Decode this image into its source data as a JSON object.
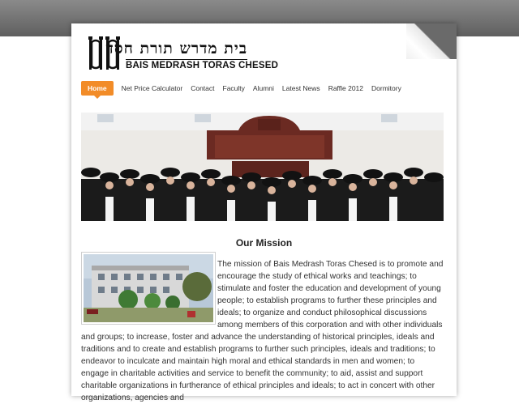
{
  "site": {
    "hebrew_name": "בית מדרש תורת חסד",
    "english_name": "BAIS MEDRASH TORAS CHESED"
  },
  "nav": {
    "items": [
      {
        "label": "Home",
        "active": true
      },
      {
        "label": "Net Price Calculator",
        "active": false
      },
      {
        "label": "Contact",
        "active": false
      },
      {
        "label": "Faculty",
        "active": false
      },
      {
        "label": "Alumni",
        "active": false
      },
      {
        "label": "Latest News",
        "active": false
      },
      {
        "label": "Raffle 2012",
        "active": false
      },
      {
        "label": "Dormitory",
        "active": false
      }
    ]
  },
  "main": {
    "title": "Our Mission",
    "paragraph": "The mission of Bais Medrash Toras Chesed is to promote and encourage the study of ethical works and teachings; to stimulate and foster the education and development of young people; to establish programs to further these principles and ideals; to organize and conduct philosophical discussions among members of this corporation and with other individuals and groups; to increase, foster and advance the understanding of historical principles, ideals and traditions and to create and establish programs to further such principles, ideals and traditions; to endeavor to inculcate and maintain high moral and ethical standards in men and women; to engage in charitable activities and service to benefit the community; to aid, assist and support charitable organizations in furtherance of ethical principles and ideals; to act in concert with other organizations, agencies and"
  },
  "colors": {
    "nav_active": "#f28c28",
    "top_band": "#6e6e6e"
  }
}
